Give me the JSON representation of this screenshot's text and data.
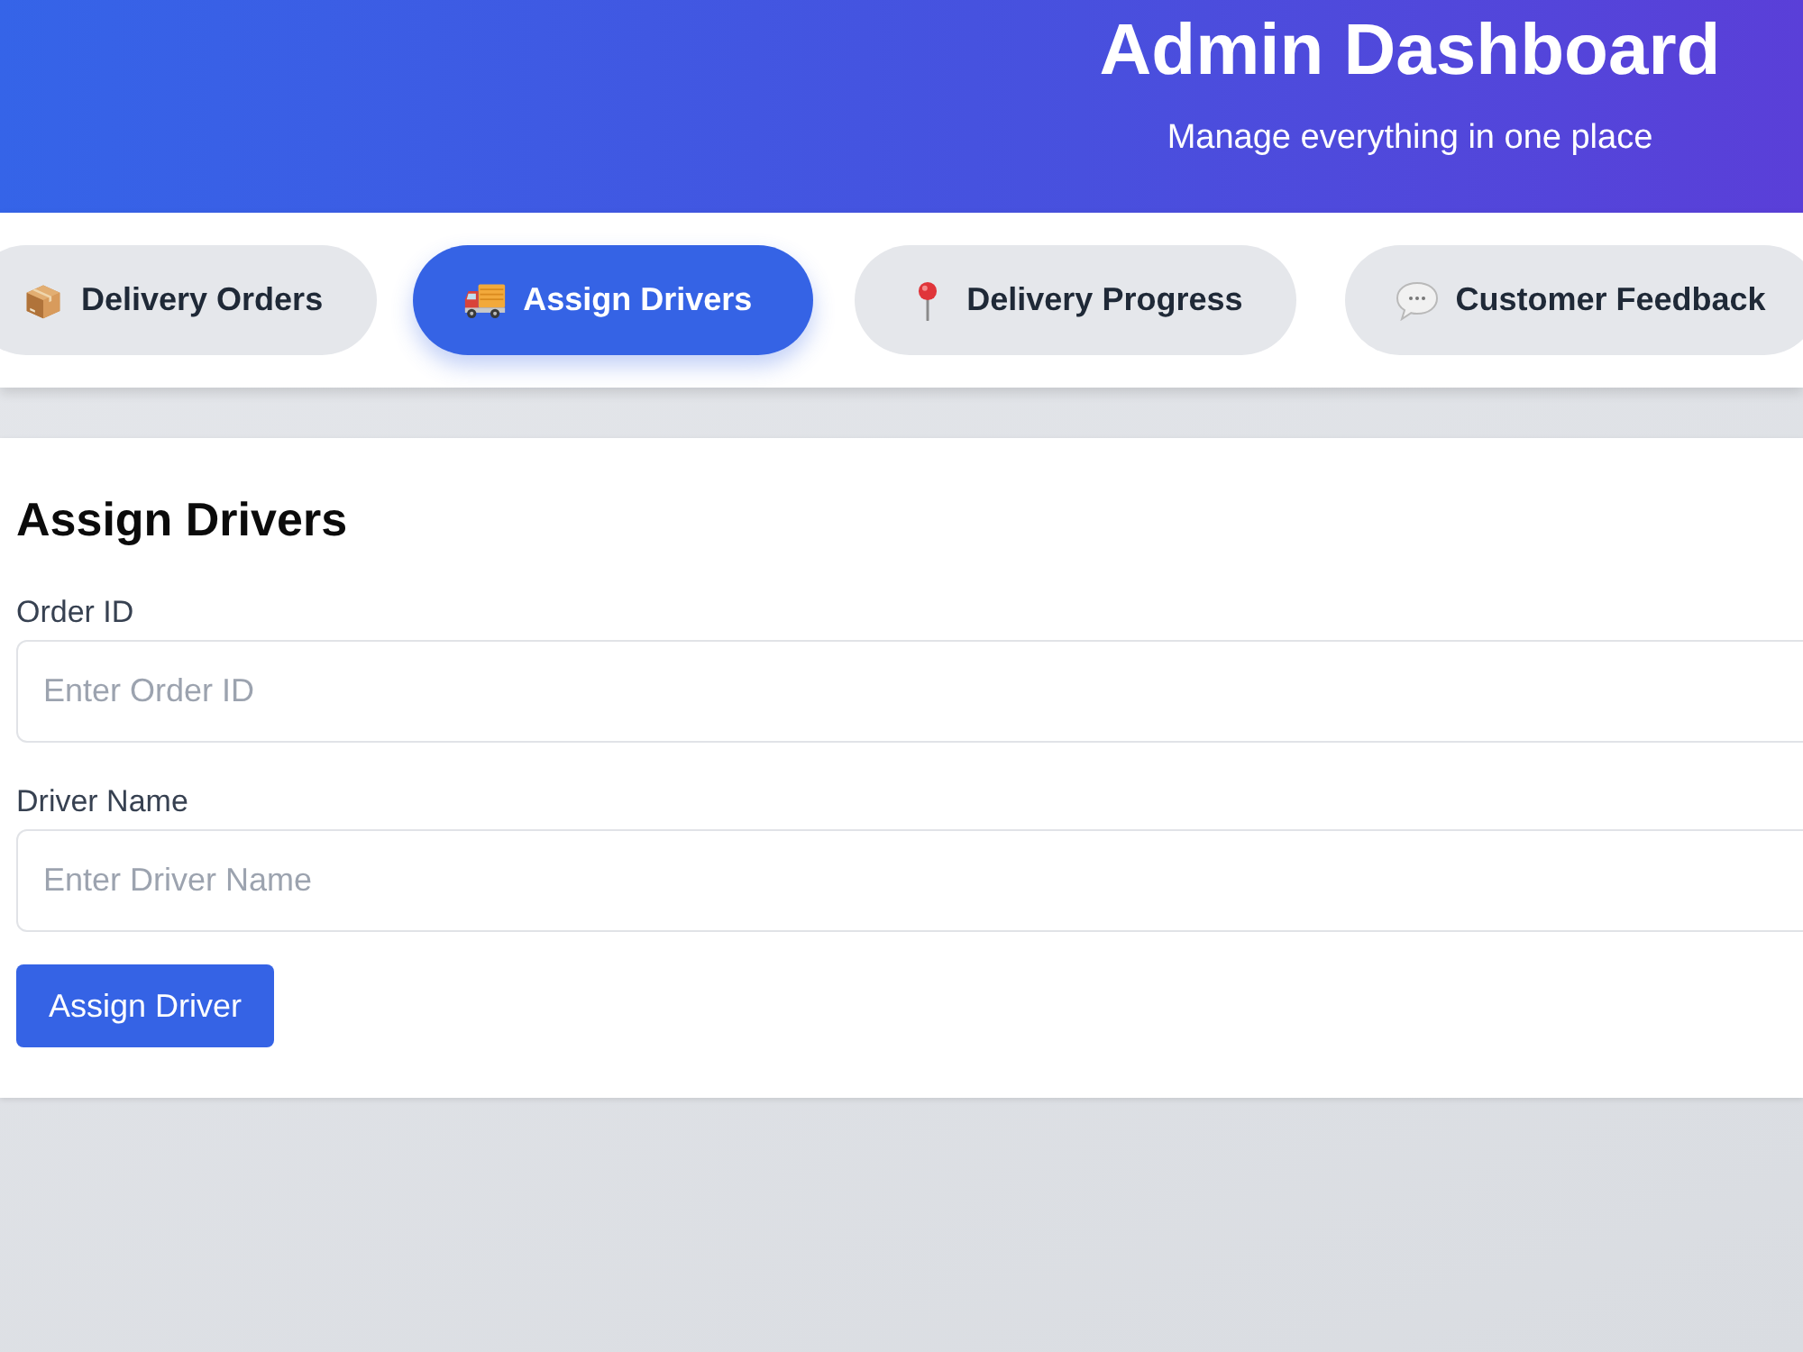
{
  "header": {
    "title": "Admin Dashboard",
    "subtitle": "Manage everything in one place"
  },
  "tabs": [
    {
      "label": "Delivery Orders",
      "selected": false
    },
    {
      "label": "Assign Drivers",
      "selected": true
    },
    {
      "label": "Delivery Progress",
      "selected": false
    },
    {
      "label": "Customer Feedback",
      "selected": false
    }
  ],
  "form": {
    "title": "Assign Drivers",
    "fields": [
      {
        "label": "Order ID",
        "placeholder": "Enter Order ID"
      },
      {
        "label": "Driver Name",
        "placeholder": "Enter Driver Name"
      }
    ],
    "submit_button": "Assign Driver"
  }
}
